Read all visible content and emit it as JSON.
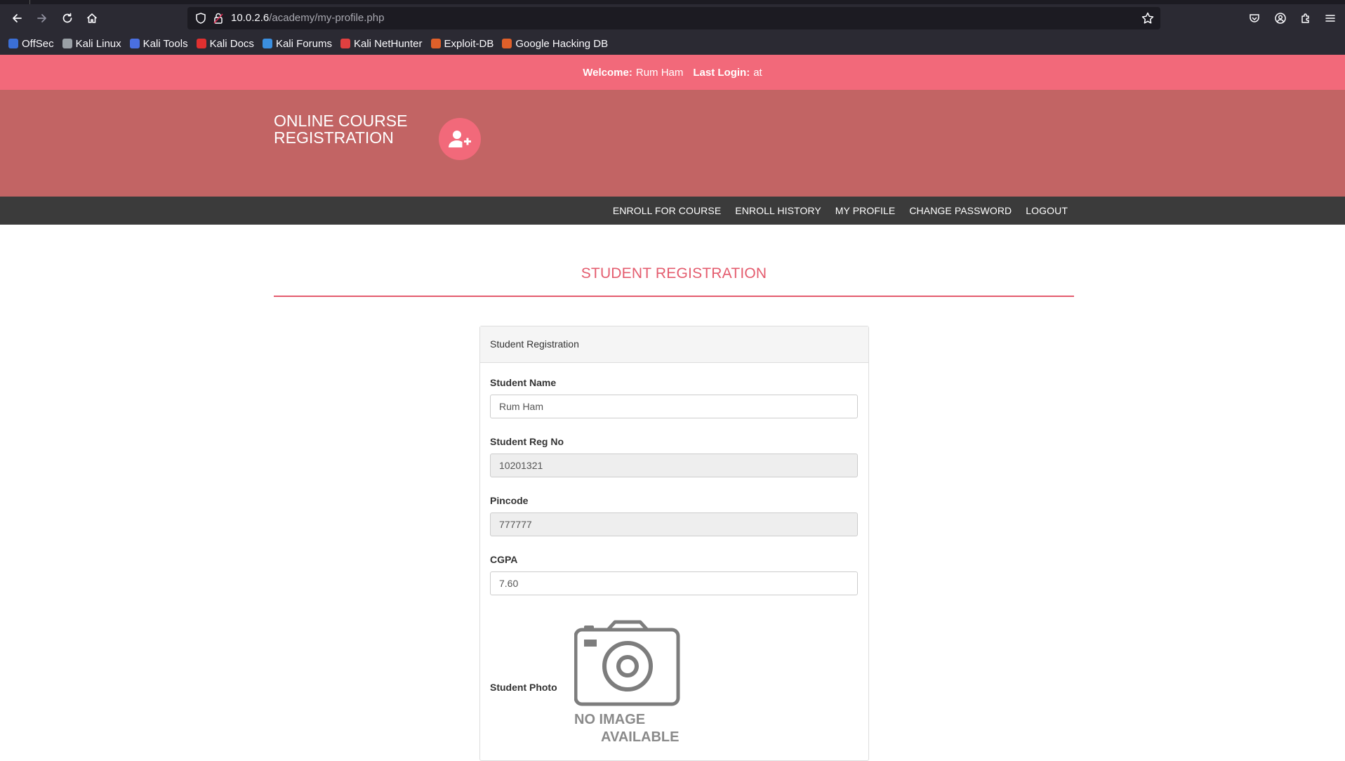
{
  "browser": {
    "url_host": "10.0.2.6",
    "url_path": "/academy/my-profile.php",
    "bookmarks": [
      {
        "label": "OffSec",
        "color": "#3b6fd6"
      },
      {
        "label": "Kali Linux",
        "color": "#9aa0a6"
      },
      {
        "label": "Kali Tools",
        "color": "#4a6fe0"
      },
      {
        "label": "Kali Docs",
        "color": "#e03030"
      },
      {
        "label": "Kali Forums",
        "color": "#3b8fe0"
      },
      {
        "label": "Kali NetHunter",
        "color": "#e04040"
      },
      {
        "label": "Exploit-DB",
        "color": "#e0602a"
      },
      {
        "label": "Google Hacking DB",
        "color": "#e0602a"
      }
    ]
  },
  "welcome": {
    "welcome_label": "Welcome:",
    "user_name": "Rum Ham",
    "last_login_label": "Last Login:",
    "last_login_value": "at"
  },
  "header": {
    "brand_line1": "ONLINE COURSE",
    "brand_line2": "REGISTRATION"
  },
  "menu": {
    "items": [
      "ENROLL FOR COURSE",
      "ENROLL HISTORY",
      "MY PROFILE",
      "CHANGE PASSWORD",
      "LOGOUT"
    ]
  },
  "page": {
    "title": "STUDENT REGISTRATION"
  },
  "form": {
    "panel_heading": "Student Registration",
    "fields": [
      {
        "label": "Student Name",
        "value": "Rum Ham"
      },
      {
        "label": "Student Reg No",
        "value": "10201321"
      },
      {
        "label": "Pincode",
        "value": "777777"
      },
      {
        "label": "CGPA",
        "value": "7.60"
      }
    ],
    "photo_label": "Student Photo",
    "no_image_line1": "NO IMAGE",
    "no_image_line2": "AVAILABLE"
  },
  "colors": {
    "accent": "#f2697a",
    "header_bg": "#c26464",
    "menu_bg": "#3b3b3b",
    "title_color": "#e45c6e"
  }
}
